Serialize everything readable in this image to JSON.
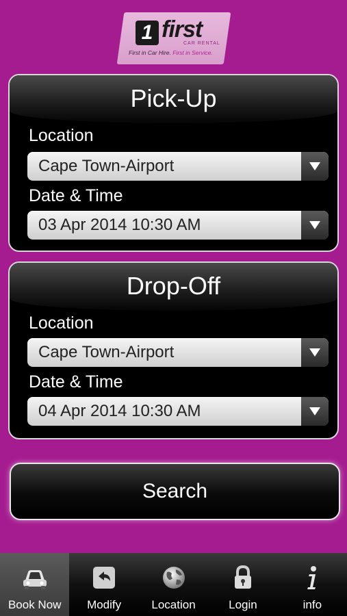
{
  "logo": {
    "mark": "1",
    "word": "first",
    "sub": "CAR RENTAL",
    "tag_part1": "First in Car Hire.",
    "tag_part2": "First in Service."
  },
  "pickup": {
    "title": "Pick-Up",
    "location_label": "Location",
    "location_value": "Cape Town-Airport",
    "datetime_label": "Date & Time",
    "datetime_value": "03 Apr 2014 10:30 AM"
  },
  "dropoff": {
    "title": "Drop-Off",
    "location_label": "Location",
    "location_value": "Cape Town-Airport",
    "datetime_label": "Date & Time",
    "datetime_value": "04 Apr 2014 10:30 AM"
  },
  "search_label": "Search",
  "tabs": [
    {
      "label": "Book Now",
      "icon": "car-icon"
    },
    {
      "label": "Modify",
      "icon": "back-arrow-icon"
    },
    {
      "label": "Location",
      "icon": "globe-icon"
    },
    {
      "label": "Login",
      "icon": "lock-icon"
    },
    {
      "label": "info",
      "icon": "info-icon"
    }
  ],
  "colors": {
    "background": "#a51c90",
    "logo_bg": "#e0acd4"
  }
}
